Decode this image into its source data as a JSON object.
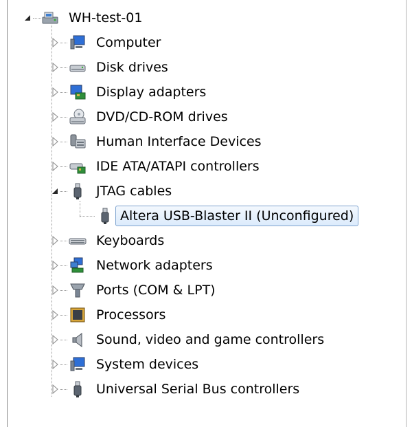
{
  "tree": {
    "root": {
      "label": "WH-test-01",
      "icon": "computer-network-icon",
      "expanded": true
    },
    "categories": [
      {
        "label": "Computer",
        "icon": "computer-icon",
        "expanded": false
      },
      {
        "label": "Disk drives",
        "icon": "disk-drive-icon",
        "expanded": false
      },
      {
        "label": "Display adapters",
        "icon": "display-adapter-icon",
        "expanded": false
      },
      {
        "label": "DVD/CD-ROM drives",
        "icon": "dvd-drive-icon",
        "expanded": false
      },
      {
        "label": "Human Interface Devices",
        "icon": "hid-icon",
        "expanded": false
      },
      {
        "label": "IDE ATA/ATAPI controllers",
        "icon": "ide-controller-icon",
        "expanded": false
      },
      {
        "label": "JTAG cables",
        "icon": "usb-plug-icon",
        "expanded": true,
        "children": [
          {
            "label": "Altera USB-Blaster II (Unconfigured)",
            "icon": "usb-plug-icon",
            "selected": true
          }
        ]
      },
      {
        "label": "Keyboards",
        "icon": "keyboard-icon",
        "expanded": false
      },
      {
        "label": "Network adapters",
        "icon": "network-adapter-icon",
        "expanded": false
      },
      {
        "label": "Ports (COM & LPT)",
        "icon": "port-icon",
        "expanded": false
      },
      {
        "label": "Processors",
        "icon": "processor-icon",
        "expanded": false
      },
      {
        "label": "Sound, video and game controllers",
        "icon": "speaker-icon",
        "expanded": false
      },
      {
        "label": "System devices",
        "icon": "system-device-icon",
        "expanded": false
      },
      {
        "label": "Universal Serial Bus controllers",
        "icon": "usb-plug-icon",
        "expanded": false
      }
    ]
  },
  "colors": {
    "selection_border": "#7da2ce",
    "selection_fill": "#dcebfc",
    "tree_lines": "#9a9a9a"
  }
}
